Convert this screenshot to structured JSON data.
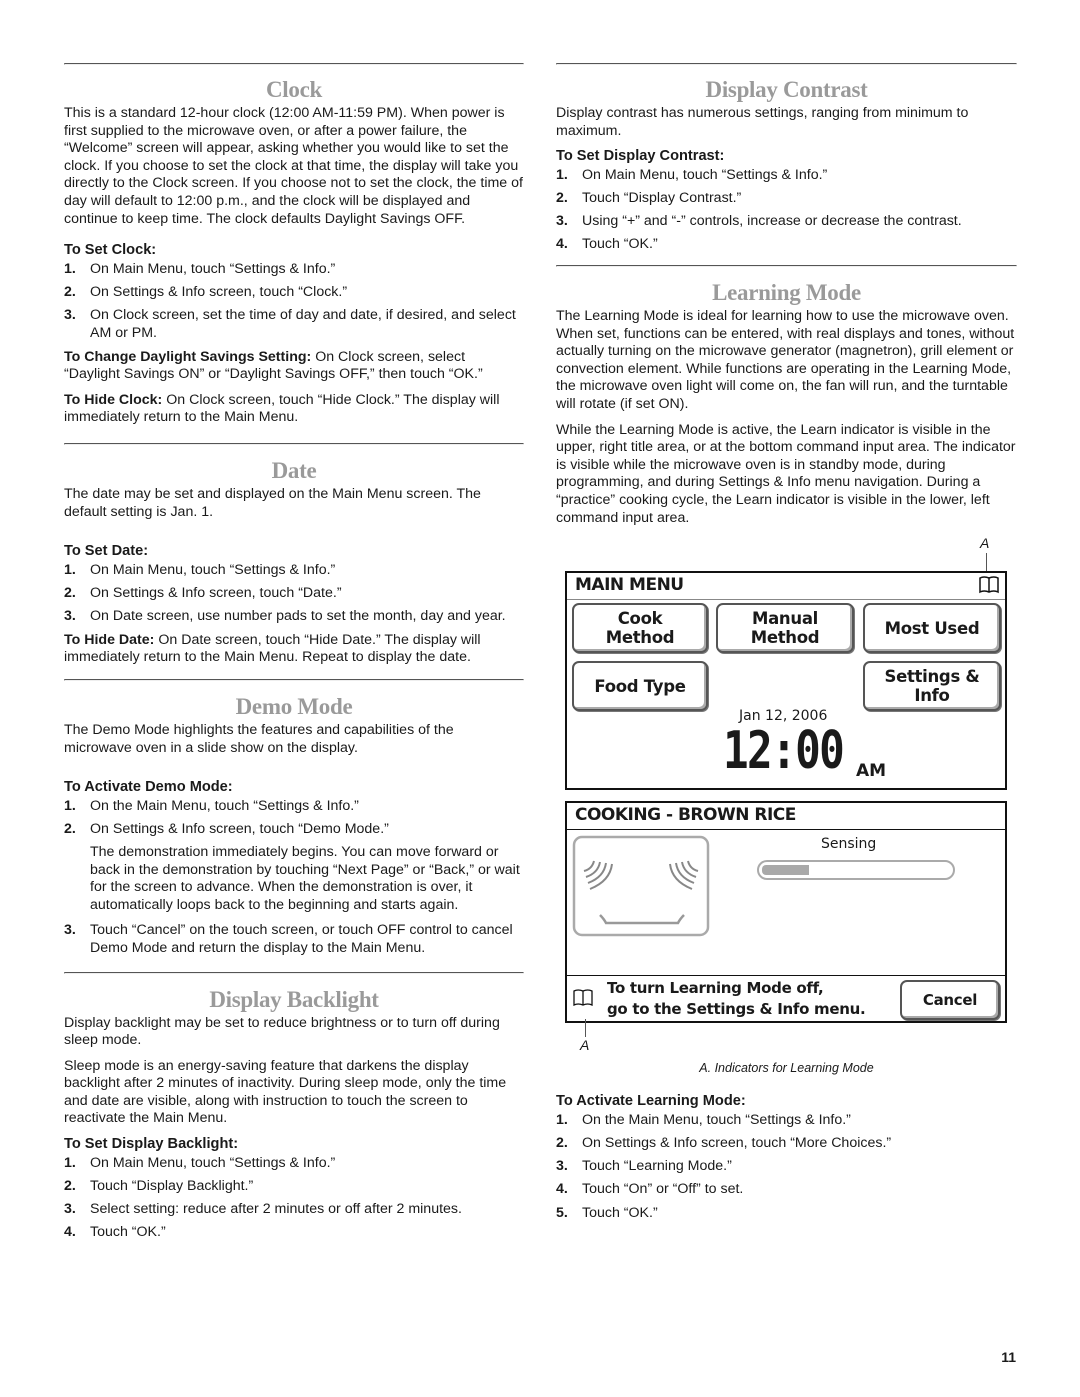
{
  "page_number": "11",
  "left": {
    "clock": {
      "title": "Clock",
      "intro": "This is a standard 12-hour clock (12:00 AM-11:59 PM). When power is first supplied to the microwave oven, or after a power failure, the “Welcome” screen will appear, asking whether you would like to set the clock. If you choose to set the clock at that time, the display will take you directly to the Clock screen. If you choose not to set the clock, the time of day will default to 12:00 p.m., and the clock will be displayed and continue to keep time. The clock defaults Daylight Savings OFF.",
      "subhead": "To Set Clock:",
      "steps": [
        {
          "n": "1.",
          "text": "On Main Menu, touch “Settings & Info.”"
        },
        {
          "n": "2.",
          "text": "On Settings & Info screen, touch “Clock.”"
        },
        {
          "n": "3.",
          "text": "On Clock screen, set the time of day and date, if desired, and select AM or PM."
        }
      ],
      "dst_label": "To Change Daylight Savings Setting:",
      "dst_text": " On Clock screen, select “Daylight Savings ON” or “Daylight Savings OFF,” then touch “OK.”",
      "hide_label": "To Hide Clock:",
      "hide_text": " On Clock screen, touch “Hide Clock.” The display will immediately return to the Main Menu."
    },
    "date": {
      "title": "Date",
      "intro": "The date may be set and displayed on the Main Menu screen. The default setting is Jan. 1.",
      "subhead": "To Set Date:",
      "steps": [
        {
          "n": "1.",
          "text": "On Main Menu, touch “Settings & Info.”"
        },
        {
          "n": "2.",
          "text": "On Settings & Info screen, touch “Date.”"
        },
        {
          "n": "3.",
          "text": "On Date screen, use number pads to set the month, day and year."
        }
      ],
      "hide_label": "To Hide Date:",
      "hide_text": " On Date screen, touch “Hide Date.” The display will immediately return to the Main Menu. Repeat to display the date."
    },
    "demo": {
      "title": "Demo Mode",
      "intro": "The Demo Mode highlights the features and capabilities of the microwave oven in a slide show on the display.",
      "subhead": "To Activate Demo Mode:",
      "steps": [
        {
          "n": "1.",
          "text": "On the Main Menu, touch “Settings & Info.”"
        },
        {
          "n": "2.",
          "text": "On Settings & Info screen, touch “Demo Mode.”",
          "extra": "The demonstration immediately begins. You can move forward or back in the demonstration by touching “Next Page” or “Back,” or wait for the screen to advance. When the demonstration is over, it automatically loops back to the beginning and starts again."
        },
        {
          "n": "3.",
          "text": "Touch “Cancel” on the touch screen, or touch OFF control to cancel Demo Mode and return the display to the Main Menu."
        }
      ]
    },
    "backlight": {
      "title": "Display Backlight",
      "intro1": "Display backlight may be set to reduce brightness or to turn off during sleep mode.",
      "intro2": "Sleep mode is an energy-saving feature that darkens the display backlight after 2 minutes of inactivity. During sleep mode, only the time and date are visible, along with instruction to touch the screen to reactivate the Main Menu.",
      "subhead": "To Set Display Backlight:",
      "steps": [
        {
          "n": "1.",
          "text": "On Main Menu, touch “Settings & Info.”"
        },
        {
          "n": "2.",
          "text": "Touch “Display Backlight.”"
        },
        {
          "n": "3.",
          "text": "Select setting: reduce after 2 minutes or off after 2 minutes."
        },
        {
          "n": "4.",
          "text": "Touch “OK.”"
        }
      ]
    }
  },
  "right": {
    "contrast": {
      "title": "Display Contrast",
      "intro": "Display contrast has numerous settings, ranging from minimum to maximum.",
      "subhead": "To Set Display Contrast:",
      "steps": [
        {
          "n": "1.",
          "text": "On Main Menu, touch “Settings & Info.”"
        },
        {
          "n": "2.",
          "text": "Touch “Display Contrast.”"
        },
        {
          "n": "3.",
          "text": "Using “+” and “-” controls, increase or decrease the contrast."
        },
        {
          "n": "4.",
          "text": "Touch “OK.”"
        }
      ]
    },
    "learning": {
      "title": "Learning Mode",
      "intro1": "The Learning Mode is ideal for learning how to use the microwave oven. When set, functions can be entered, with real displays and tones, without actually turning on the microwave generator (magnetron), grill element or convection element. While functions are operating in the Learning Mode, the microwave oven light will come on, the fan will run, and the turntable will rotate (if set ON).",
      "intro2": "While the Learning Mode is active, the Learn indicator is visible in the upper, right title area, or at the bottom command input area. The indicator is visible while the microwave oven is in standby mode, during programming, and during Settings & Info menu navigation. During a “practice” cooking cycle, the Learn indicator is visible in the lower, left command input area.",
      "subhead": "To Activate Learning Mode:",
      "steps": [
        {
          "n": "1.",
          "text": "On the Main Menu, touch “Settings & Info.”"
        },
        {
          "n": "2.",
          "text": "On Settings & Info screen, touch “More Choices.”"
        },
        {
          "n": "3.",
          "text": "Touch “Learning Mode.”"
        },
        {
          "n": "4.",
          "text": "Touch “On” or “Off” to set."
        },
        {
          "n": "5.",
          "text": "Touch “OK.”"
        }
      ]
    },
    "figure": {
      "label_a_top": "A",
      "label_a_bottom": "A",
      "caption": "A. Indicators for Learning Mode",
      "main_menu": {
        "title": "MAIN MENU",
        "learn_icon": "book-icon",
        "buttons": {
          "cook_method": "Cook\nMethod",
          "manual_method": "Manual\nMethod",
          "most_used": "Most Used",
          "food_type": "Food Type",
          "settings_info": "Settings &\nInfo"
        },
        "date": "Jan 12, 2006",
        "time": "12:00",
        "ampm": "AM"
      },
      "cooking": {
        "title": "COOKING - BROWN RICE",
        "status": "Sensing",
        "progress_fraction": 0.25,
        "message_line1": "To turn Learning Mode off,",
        "message_line2": "go to the Settings & Info menu.",
        "cancel": "Cancel",
        "learn_icon": "book-icon"
      }
    }
  }
}
